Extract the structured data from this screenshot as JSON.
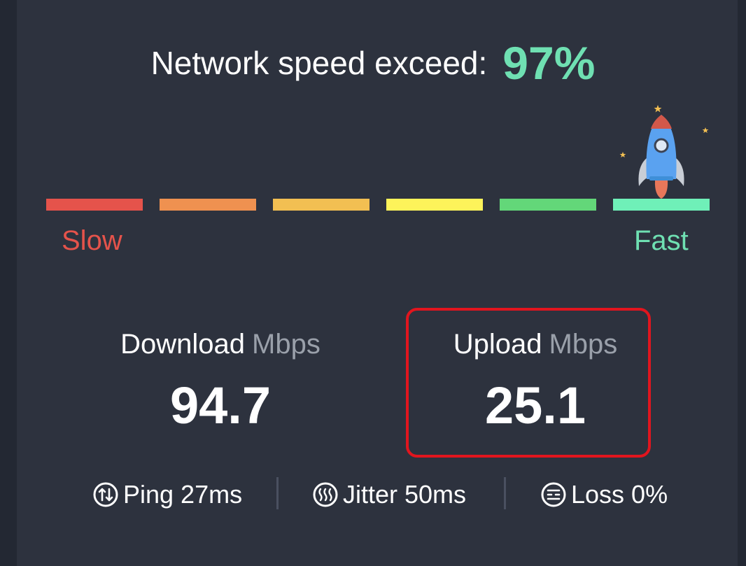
{
  "headline": {
    "label": "Network speed exceed:",
    "percent": "97%"
  },
  "scale": {
    "slow_label": "Slow",
    "fast_label": "Fast",
    "segment_colors": [
      "#e5534b",
      "#ef9150",
      "#f2bf52",
      "#fdf35a",
      "#63d779",
      "#6ff0b8"
    ],
    "slow_color": "#e5534b",
    "fast_color": "#6fe0b2"
  },
  "download": {
    "title": "Download",
    "unit": "Mbps",
    "value": "94.7"
  },
  "upload": {
    "title": "Upload",
    "unit": "Mbps",
    "value": "25.1"
  },
  "metrics": {
    "ping": "Ping 27ms",
    "jitter": "Jitter 50ms",
    "loss": "Loss 0%"
  },
  "icons": [
    "rocket-icon",
    "ping-icon",
    "jitter-icon",
    "loss-icon"
  ],
  "colors": {
    "accent": "#6fe0b2",
    "highlight_border": "#e1151e",
    "card_bg": "#2d323e"
  }
}
